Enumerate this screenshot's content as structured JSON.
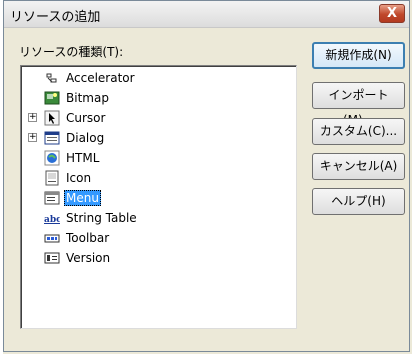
{
  "window": {
    "title": "リソースの追加",
    "close_label": "X"
  },
  "tree_label": "リソースの種類(T):",
  "tree": {
    "items": [
      {
        "label": "Accelerator",
        "icon": "accelerator-icon",
        "expandable": false,
        "selected": false
      },
      {
        "label": "Bitmap",
        "icon": "bitmap-icon",
        "expandable": false,
        "selected": false
      },
      {
        "label": "Cursor",
        "icon": "cursor-icon",
        "expandable": true,
        "selected": false
      },
      {
        "label": "Dialog",
        "icon": "dialog-icon",
        "expandable": true,
        "selected": false
      },
      {
        "label": "HTML",
        "icon": "html-icon",
        "expandable": false,
        "selected": false
      },
      {
        "label": "Icon",
        "icon": "icon-resource-icon",
        "expandable": false,
        "selected": false
      },
      {
        "label": "Menu",
        "icon": "menu-icon",
        "expandable": false,
        "selected": true
      },
      {
        "label": "String Table",
        "icon": "string-table-icon",
        "expandable": false,
        "selected": false
      },
      {
        "label": "Toolbar",
        "icon": "toolbar-icon",
        "expandable": false,
        "selected": false
      },
      {
        "label": "Version",
        "icon": "version-icon",
        "expandable": false,
        "selected": false
      }
    ],
    "expander_symbol": "+"
  },
  "buttons": {
    "new": "新規作成(N)",
    "import": "インポート(M)...",
    "custom": "カスタム(C)...",
    "cancel": "キャンセル(A)",
    "help": "ヘルプ(H)"
  }
}
